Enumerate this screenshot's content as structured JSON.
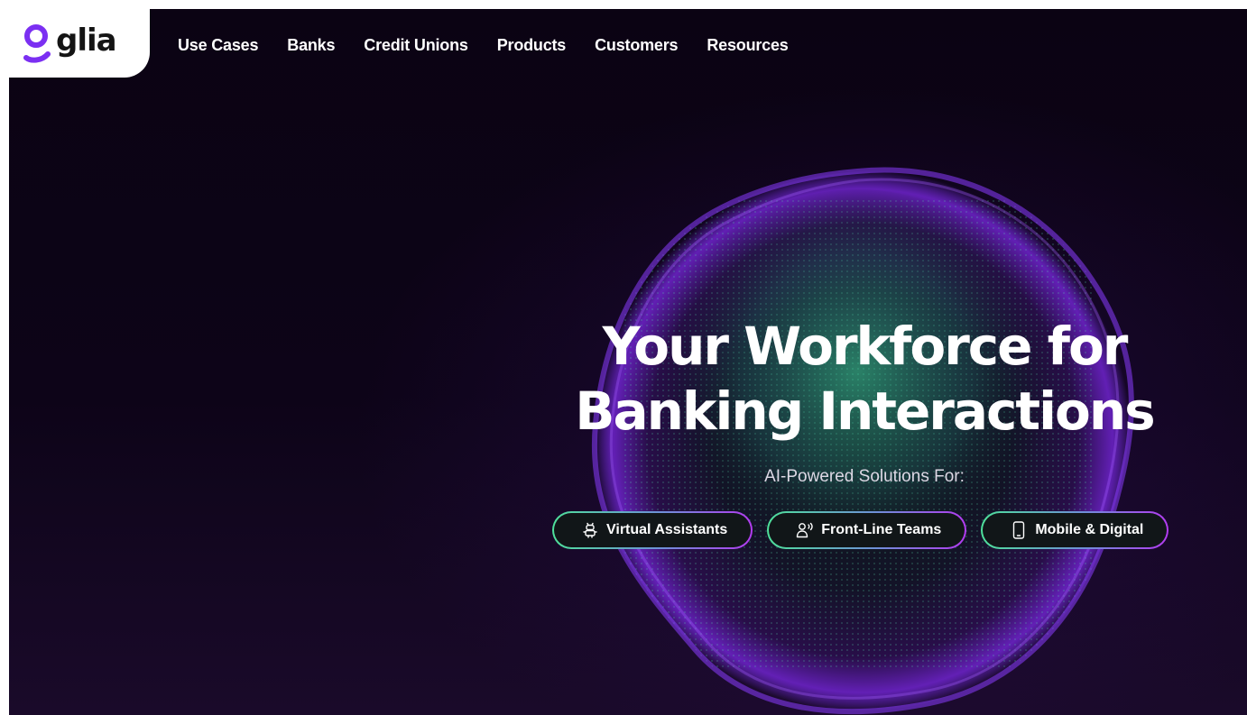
{
  "brand": {
    "name": "glia",
    "logo_icon": "glia-g-icon",
    "accent_color": "#7b2ff2"
  },
  "nav": {
    "items": [
      {
        "label": "Use Cases"
      },
      {
        "label": "Banks"
      },
      {
        "label": "Credit Unions"
      },
      {
        "label": "Products"
      },
      {
        "label": "Customers"
      },
      {
        "label": "Resources"
      }
    ]
  },
  "hero": {
    "headline_line1": "Your Workforce for",
    "headline_line2": "Banking Interactions",
    "subheading": "AI-Powered Solutions For:",
    "buttons": [
      {
        "label": "Virtual Assistants",
        "icon": "robot-icon"
      },
      {
        "label": "Front-Line Teams",
        "icon": "person-speaking-icon"
      },
      {
        "label": "Mobile & Digital",
        "icon": "mobile-phone-icon"
      }
    ]
  },
  "colors": {
    "background": "#0d0418",
    "orb_glow": "#7b2ff2",
    "pill_border_start": "#4ee09a",
    "pill_border_end": "#b23bf0",
    "pill_fill": "#111618"
  }
}
